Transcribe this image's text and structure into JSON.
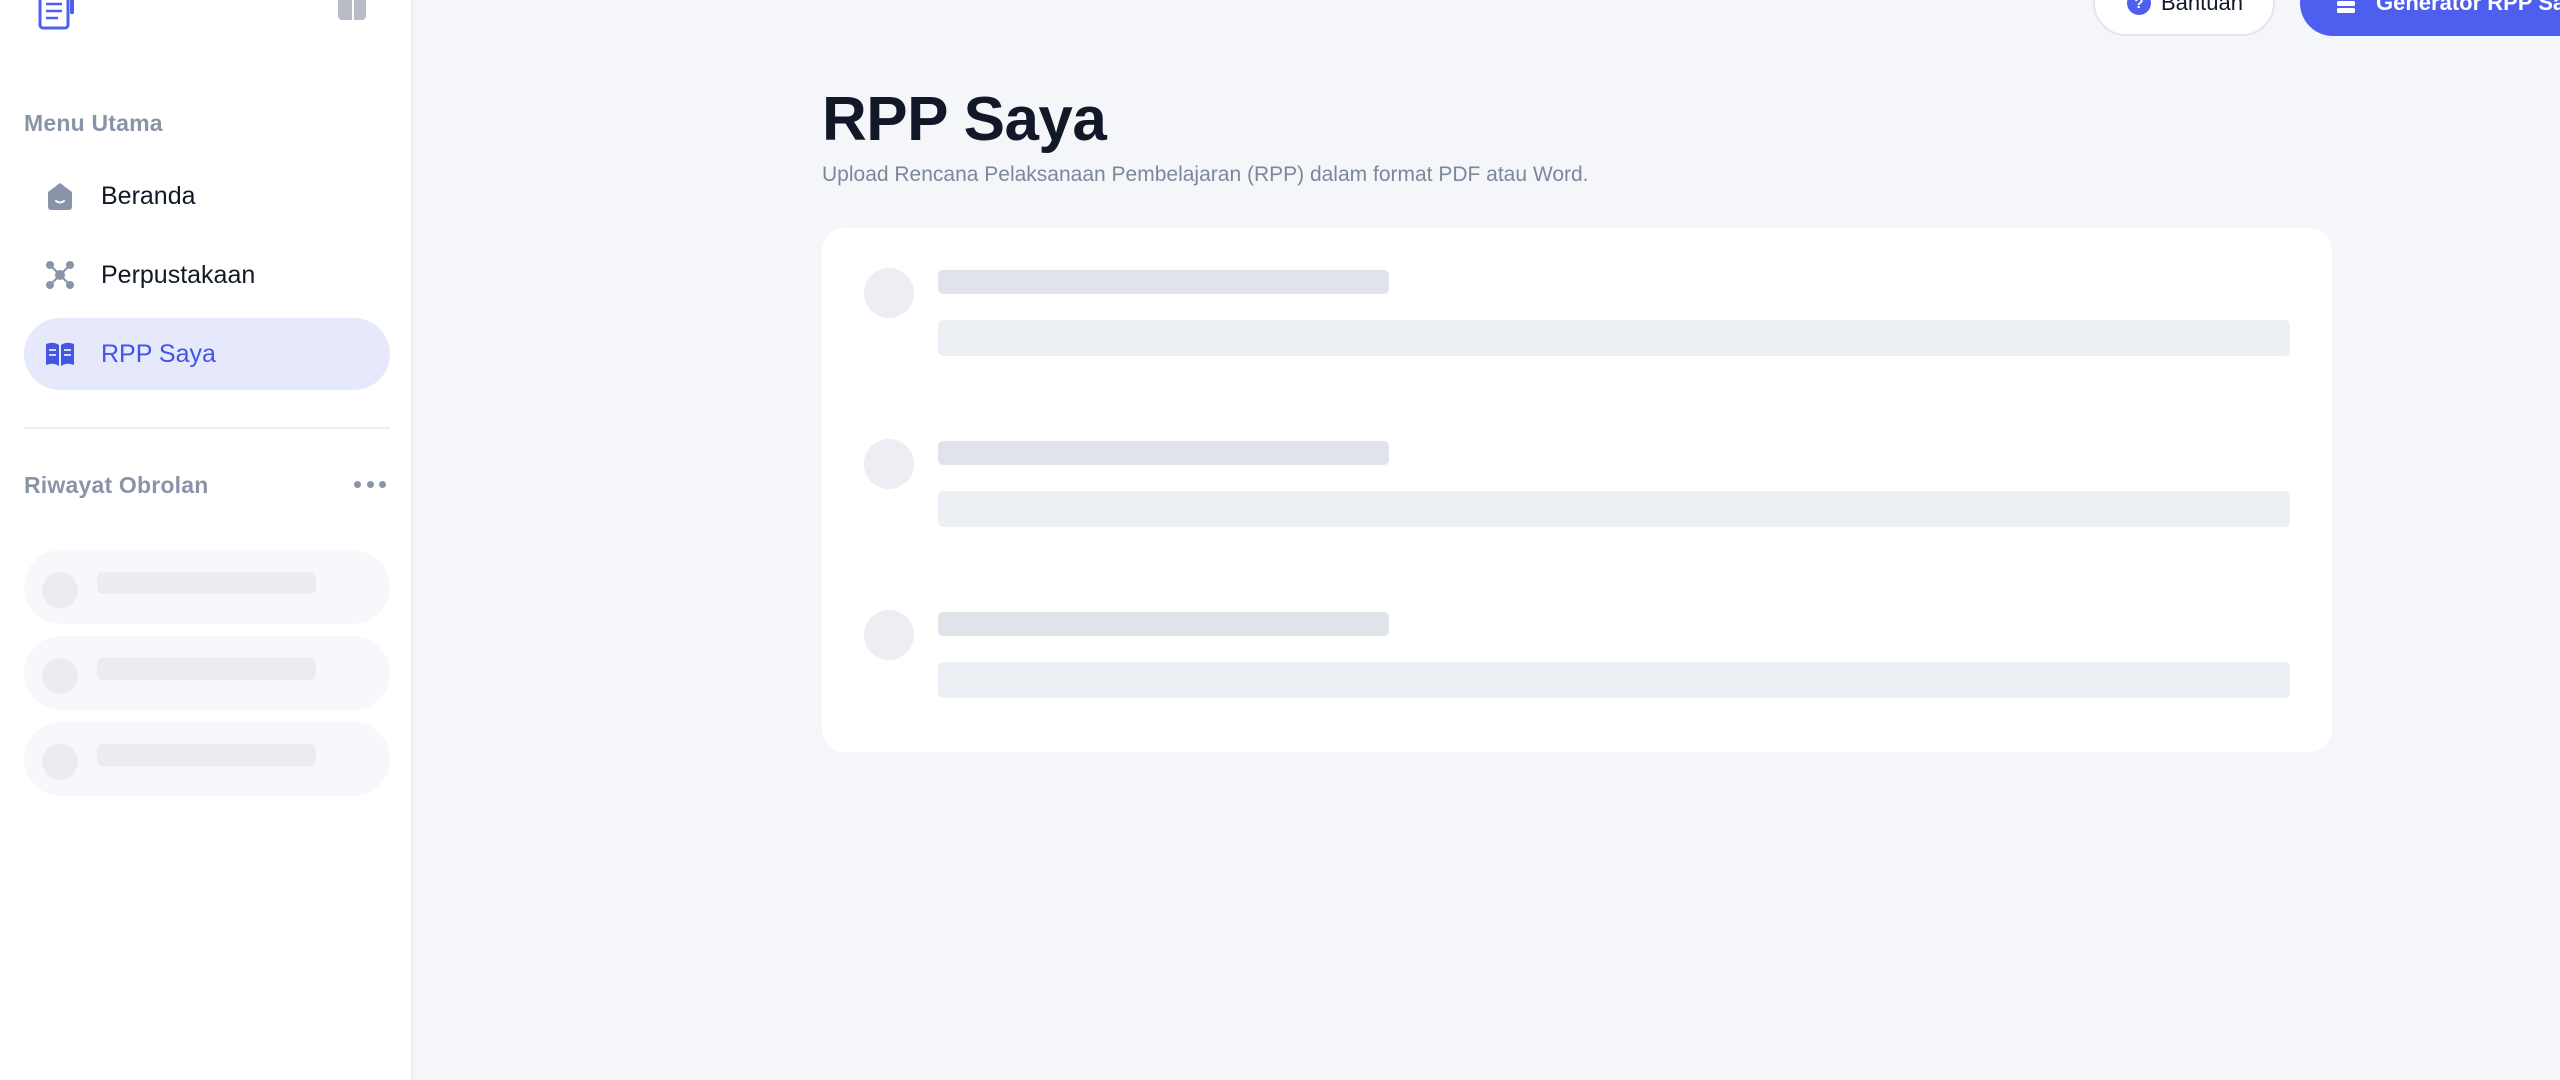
{
  "sidebar": {
    "main_menu_label": "Menu Utama",
    "items": [
      {
        "label": "Beranda",
        "icon": "home-icon"
      },
      {
        "label": "Perpustakaan",
        "icon": "library-icon"
      },
      {
        "label": "RPP Saya",
        "icon": "book-open-icon",
        "active": true
      }
    ],
    "chat_history_label": "Riwayat Obrolan"
  },
  "header": {
    "help_label": "Bantuan",
    "help_icon_glyph": "?",
    "generator_label": "Generator RPP Saya"
  },
  "main": {
    "title": "RPP Saya",
    "subtitle": "Upload Rencana Pelaksanaan Pembelajaran (RPP) dalam format PDF atau Word."
  },
  "colors": {
    "accent": "#4e5ff0",
    "active_bg": "#e6e8fb",
    "active_text": "#4355e3",
    "muted_text": "#8a94a8",
    "page_bg": "#f5f6fa"
  }
}
